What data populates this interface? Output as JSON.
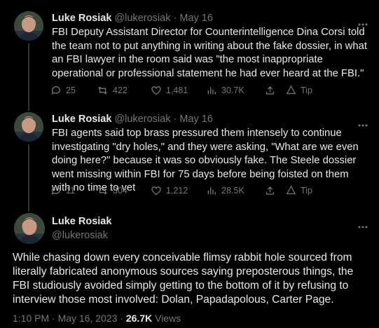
{
  "tweets": [
    {
      "name": "Luke Rosiak",
      "handle": "@lukerosiak",
      "sep": "·",
      "date": "May 16",
      "text": "FBI Deputy Assistant Director for Counterintelligence Dina Corsi told the team not to put anything in writing about the fake dossier, in what an FBI lawyer in the room said was \"the most inappropriate operational or professional statement he had ever heard at the FBI.\"",
      "replies": "25",
      "retweets": "422",
      "likes": "1,481",
      "views": "30.7K",
      "tip": "Tip"
    },
    {
      "name": "Luke Rosiak",
      "handle": "@lukerosiak",
      "sep": "·",
      "date": "May 16",
      "text": "FBI agents said top brass pressured them intensely to continue investigating \"dry holes,\" and they were asking, \"What are we even doing here?\" because it was so obviously fake. The Steele dossier went missing within FBI for 75 days before being foisted on them with no time to vet",
      "replies": "11",
      "retweets": "304",
      "likes": "1,212",
      "views": "28.5K",
      "tip": "Tip"
    }
  ],
  "main_tweet": {
    "name": "Luke Rosiak",
    "handle": "@lukerosiak",
    "text": "While chasing down every conceivable flimsy rabbit hole sourced from literally fabricated anonymous sources saying preposterous things, the FBI studiously avoided simply getting to the bottom of it by refusing to interview those most involved: Dolan, Papadapolous, Carter Page.",
    "time": "1:10 PM · May 16, 2023 · ",
    "views_count": "26.7K",
    "views_label": " Views"
  },
  "icons": {
    "reply": "reply-icon",
    "retweet": "retweet-icon",
    "like": "like-icon",
    "views": "views-icon",
    "share": "share-icon",
    "tip": "tip-icon",
    "more": "more-icon"
  },
  "colors": {
    "background": "#000000",
    "text": "#e7e9ea",
    "muted": "#71767b",
    "divider": "#2f3336"
  }
}
